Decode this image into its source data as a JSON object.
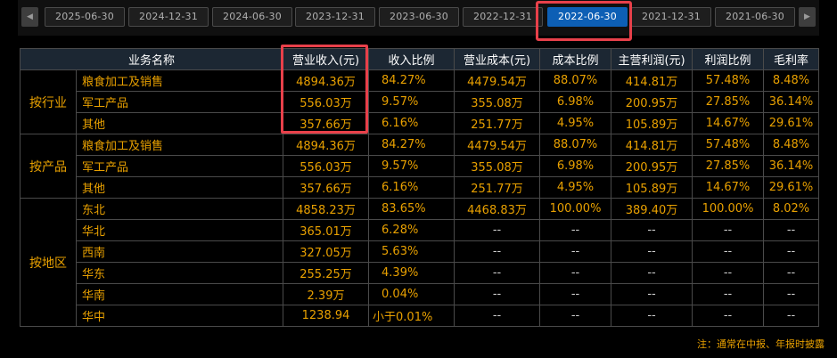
{
  "nav": {
    "prev_icon": "◀",
    "next_icon": "▶",
    "tabs": [
      {
        "label": "2025-06-30"
      },
      {
        "label": "2024-12-31"
      },
      {
        "label": "2024-06-30"
      },
      {
        "label": "2023-12-31"
      },
      {
        "label": "2023-06-30"
      },
      {
        "label": "2022-12-31"
      },
      {
        "label": "2022-06-30"
      },
      {
        "label": "2021-12-31"
      },
      {
        "label": "2021-06-30"
      }
    ],
    "active_tab": "2022-06-30"
  },
  "colors": {
    "value": "#e8a000",
    "header_bg": "#1c2733",
    "active_tab": "#0d5fb5",
    "highlight": "#e8404a"
  },
  "table": {
    "headers": [
      "业务名称",
      "营业收入(元)",
      "收入比例",
      "营业成本(元)",
      "成本比例",
      "主营利润(元)",
      "利润比例",
      "毛利率"
    ],
    "groups": [
      {
        "name": "按行业",
        "rows": [
          {
            "name": "粮食加工及销售",
            "revenue": "4894.36万",
            "rev_ratio": "84.27%",
            "cost": "4479.54万",
            "cost_ratio": "88.07%",
            "profit": "414.81万",
            "profit_ratio": "57.48%",
            "margin": "8.48%"
          },
          {
            "name": "军工产品",
            "revenue": "556.03万",
            "rev_ratio": "9.57%",
            "cost": "355.08万",
            "cost_ratio": "6.98%",
            "profit": "200.95万",
            "profit_ratio": "27.85%",
            "margin": "36.14%"
          },
          {
            "name": "其他",
            "revenue": "357.66万",
            "rev_ratio": "6.16%",
            "cost": "251.77万",
            "cost_ratio": "4.95%",
            "profit": "105.89万",
            "profit_ratio": "14.67%",
            "margin": "29.61%"
          }
        ]
      },
      {
        "name": "按产品",
        "rows": [
          {
            "name": "粮食加工及销售",
            "revenue": "4894.36万",
            "rev_ratio": "84.27%",
            "cost": "4479.54万",
            "cost_ratio": "88.07%",
            "profit": "414.81万",
            "profit_ratio": "57.48%",
            "margin": "8.48%"
          },
          {
            "name": "军工产品",
            "revenue": "556.03万",
            "rev_ratio": "9.57%",
            "cost": "355.08万",
            "cost_ratio": "6.98%",
            "profit": "200.95万",
            "profit_ratio": "27.85%",
            "margin": "36.14%"
          },
          {
            "name": "其他",
            "revenue": "357.66万",
            "rev_ratio": "6.16%",
            "cost": "251.77万",
            "cost_ratio": "4.95%",
            "profit": "105.89万",
            "profit_ratio": "14.67%",
            "margin": "29.61%"
          }
        ]
      },
      {
        "name": "按地区",
        "rows": [
          {
            "name": "东北",
            "revenue": "4858.23万",
            "rev_ratio": "83.65%",
            "cost": "4468.83万",
            "cost_ratio": "100.00%",
            "profit": "389.40万",
            "profit_ratio": "100.00%",
            "margin": "8.02%"
          },
          {
            "name": "华北",
            "revenue": "365.01万",
            "rev_ratio": "6.28%",
            "cost": "--",
            "cost_ratio": "--",
            "profit": "--",
            "profit_ratio": "--",
            "margin": "--"
          },
          {
            "name": "西南",
            "revenue": "327.05万",
            "rev_ratio": "5.63%",
            "cost": "--",
            "cost_ratio": "--",
            "profit": "--",
            "profit_ratio": "--",
            "margin": "--"
          },
          {
            "name": "华东",
            "revenue": "255.25万",
            "rev_ratio": "4.39%",
            "cost": "--",
            "cost_ratio": "--",
            "profit": "--",
            "profit_ratio": "--",
            "margin": "--"
          },
          {
            "name": "华南",
            "revenue": "2.39万",
            "rev_ratio": "0.04%",
            "cost": "--",
            "cost_ratio": "--",
            "profit": "--",
            "profit_ratio": "--",
            "margin": "--"
          },
          {
            "name": "华中",
            "revenue": "1238.94",
            "rev_ratio": "小于0.01%",
            "cost": "--",
            "cost_ratio": "--",
            "profit": "--",
            "profit_ratio": "--",
            "margin": "--"
          }
        ]
      }
    ]
  },
  "footnote": "注：通常在中报、年报时披露"
}
